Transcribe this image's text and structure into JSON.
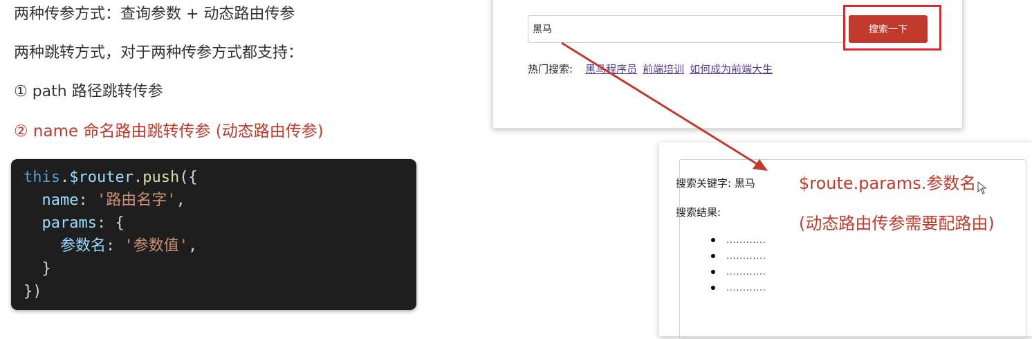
{
  "slide": {
    "line1": "两种传参方式：查询参数 + 动态路由传参",
    "line2": "两种跳转方式，对于两种传参方式都支持：",
    "line3": "① path 路径跳转传参",
    "line4": "② name 命名路由跳转传参 (动态路由传参)"
  },
  "code": {
    "l1_this": "this",
    "l1_dot": ".",
    "l1_router": "$router",
    "l1_dot2": ".",
    "l1_push": "push",
    "l1_open": "({",
    "l2_key": "name",
    "l2_colon": ": ",
    "l2_val": "'路由名字'",
    "l2_comma": ",",
    "l3_key": "params",
    "l3_rest": ": {",
    "l4_key": "参数名",
    "l4_colon": ": ",
    "l4_val": "'参数值'",
    "l4_comma": ",",
    "l5": "}",
    "l6": "})"
  },
  "search_page": {
    "input_value": "黑马",
    "button_label": "搜索一下",
    "hot_label": "热门搜索:",
    "hot_links": [
      "黑马程序员",
      "前端培训",
      "如何成为前端大生"
    ]
  },
  "result_page": {
    "keyword_label": "搜索关键字:",
    "keyword_value": "黑马",
    "results_label": "搜索结果:",
    "results": [
      "............",
      "............",
      "............",
      "............"
    ]
  },
  "annotations": {
    "params_expr": "$route.params.参数名",
    "params_note": "(动态路由传参需要配路由)"
  },
  "colors": {
    "accent_red": "#c0392b",
    "highlight_red": "#e0262b",
    "link_purple": "#5b3a8c",
    "code_bg": "#1e1e1e"
  }
}
